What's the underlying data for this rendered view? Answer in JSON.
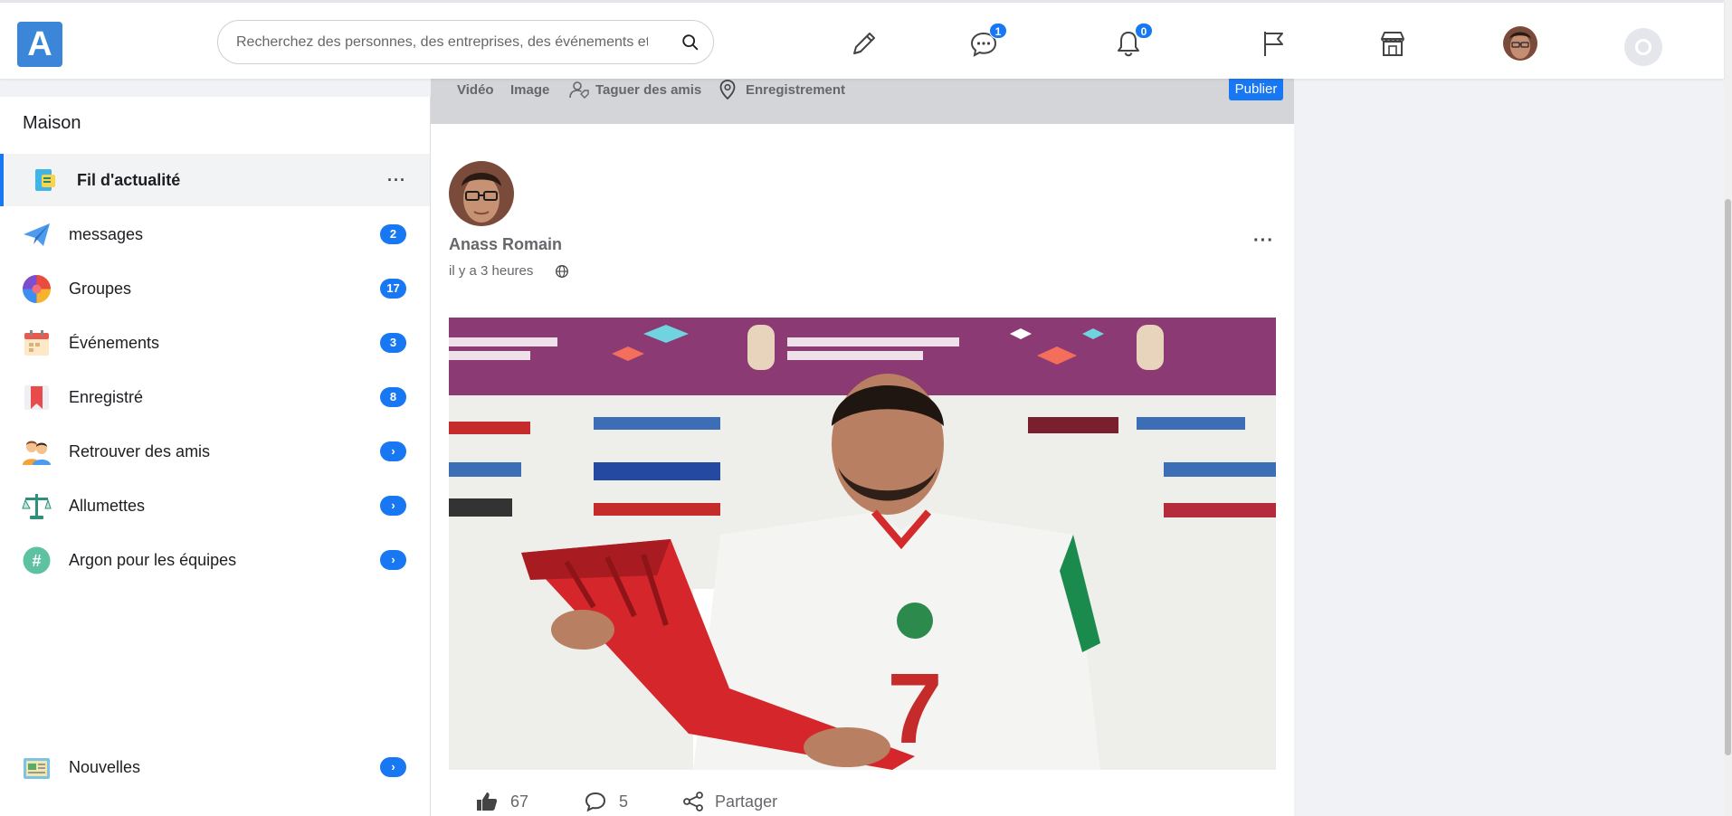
{
  "header": {
    "logo_letter": "A",
    "search_placeholder": "Recherchez des personnes, des entreprises, des événements et pl",
    "messages_count": "1",
    "notifications_count": "0"
  },
  "sidebar": {
    "title": "Maison",
    "items": [
      {
        "label": "Fil d'actualité",
        "badge": "",
        "menu": "···",
        "icon": "news-feed-icon"
      },
      {
        "label": "messages",
        "badge": "2",
        "icon": "paper-plane-icon"
      },
      {
        "label": "Groupes",
        "badge": "17",
        "icon": "groups-icon"
      },
      {
        "label": "Événements",
        "badge": "3",
        "icon": "calendar-icon"
      },
      {
        "label": "Enregistré",
        "badge": "8",
        "icon": "bookmark-icon"
      },
      {
        "label": "Retrouver des amis",
        "badge": "›",
        "icon": "friends-icon"
      },
      {
        "label": "Allumettes",
        "badge": "›",
        "icon": "matches-icon"
      },
      {
        "label": "Argon pour les équipes",
        "badge": "›",
        "icon": "teams-icon"
      },
      {
        "label": "Nouvelles",
        "badge": "›",
        "icon": "newspaper-icon"
      }
    ]
  },
  "composer": {
    "video": "Vidéo",
    "image": "Image",
    "tag": "Taguer des amis",
    "checkin": "Enregistrement",
    "publish": "Publier"
  },
  "post": {
    "author": "Anass Romain",
    "time": "il y a 3 heures",
    "menu": "···",
    "likes": "67",
    "comments": "5",
    "share": "Partager"
  },
  "colors": {
    "accent": "#1877f2",
    "logo": "#3b86d9"
  }
}
